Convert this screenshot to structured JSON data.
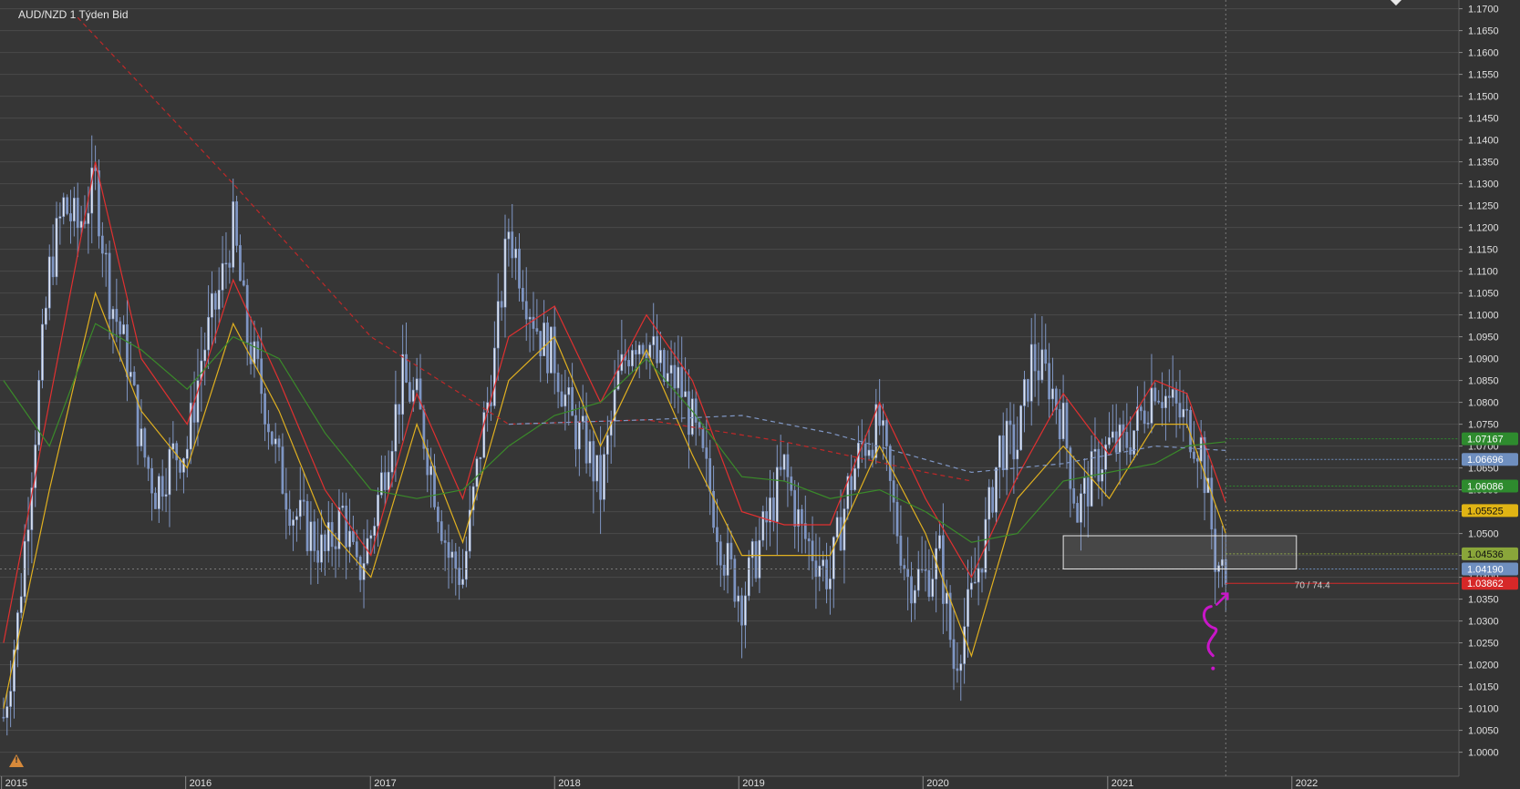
{
  "header": {
    "title": "AUD/NZD  1 Týden Bid"
  },
  "chart_data": {
    "type": "candlestick",
    "title": "AUD/NZD  1 Týden Bid",
    "xlabel": "",
    "ylabel": "",
    "ylim": [
      0.9945,
      1.172
    ],
    "x_range": [
      "2014-12-29",
      "2022-11-28"
    ],
    "x_ticks": [
      "2015",
      "2016",
      "2017",
      "2018",
      "2019",
      "2020",
      "2021",
      "2022"
    ],
    "y_ticks": [
      "1.1700",
      "1.1650",
      "1.1600",
      "1.1550",
      "1.1500",
      "1.1450",
      "1.1400",
      "1.1350",
      "1.1300",
      "1.1250",
      "1.1200",
      "1.1150",
      "1.1100",
      "1.1050",
      "1.1000",
      "1.0950",
      "1.0900",
      "1.0850",
      "1.0800",
      "1.0750",
      "1.0700",
      "1.0650",
      "1.0600",
      "1.0550",
      "1.0500",
      "1.0450",
      "1.0400",
      "1.0350",
      "1.0300",
      "1.0250",
      "1.0200",
      "1.0150",
      "1.0100",
      "1.0050",
      "1.0000"
    ],
    "close_path": [
      [
        "2015-01-05",
        1.008
      ],
      [
        "2015-02-02",
        1.03
      ],
      [
        "2015-03-02",
        1.065
      ],
      [
        "2015-04-06",
        1.11
      ],
      [
        "2015-05-04",
        1.125
      ],
      [
        "2015-06-01",
        1.12
      ],
      [
        "2015-07-06",
        1.13
      ],
      [
        "2015-08-03",
        1.105
      ],
      [
        "2015-09-07",
        1.09
      ],
      [
        "2015-10-05",
        1.07
      ],
      [
        "2015-11-02",
        1.06
      ],
      [
        "2015-12-07",
        1.068
      ],
      [
        "2016-01-04",
        1.07
      ],
      [
        "2016-02-01",
        1.09
      ],
      [
        "2016-03-07",
        1.105
      ],
      [
        "2016-04-04",
        1.12
      ],
      [
        "2016-05-02",
        1.095
      ],
      [
        "2016-06-06",
        1.08
      ],
      [
        "2016-07-04",
        1.065
      ],
      [
        "2016-08-01",
        1.055
      ],
      [
        "2016-09-05",
        1.05
      ],
      [
        "2016-10-03",
        1.045
      ],
      [
        "2016-11-07",
        1.055
      ],
      [
        "2016-12-05",
        1.04
      ],
      [
        "2017-01-02",
        1.05
      ],
      [
        "2017-02-06",
        1.07
      ],
      [
        "2017-03-06",
        1.085
      ],
      [
        "2017-04-03",
        1.08
      ],
      [
        "2017-05-01",
        1.065
      ],
      [
        "2017-06-05",
        1.045
      ],
      [
        "2017-07-03",
        1.04
      ],
      [
        "2017-08-07",
        1.07
      ],
      [
        "2017-09-04",
        1.09
      ],
      [
        "2017-10-02",
        1.12
      ],
      [
        "2017-11-06",
        1.105
      ],
      [
        "2017-12-04",
        1.095
      ],
      [
        "2018-01-01",
        1.09
      ],
      [
        "2018-02-05",
        1.075
      ],
      [
        "2018-03-05",
        1.07
      ],
      [
        "2018-04-02",
        1.06
      ],
      [
        "2018-05-07",
        1.085
      ],
      [
        "2018-06-04",
        1.095
      ],
      [
        "2018-07-02",
        1.095
      ],
      [
        "2018-08-06",
        1.085
      ],
      [
        "2018-09-03",
        1.085
      ],
      [
        "2018-10-01",
        1.075
      ],
      [
        "2018-11-05",
        1.06
      ],
      [
        "2018-12-03",
        1.045
      ],
      [
        "2019-01-07",
        1.035
      ],
      [
        "2019-02-04",
        1.045
      ],
      [
        "2019-03-04",
        1.055
      ],
      [
        "2019-04-01",
        1.065
      ],
      [
        "2019-05-06",
        1.05
      ],
      [
        "2019-06-03",
        1.045
      ],
      [
        "2019-07-01",
        1.04
      ],
      [
        "2019-08-05",
        1.06
      ],
      [
        "2019-09-02",
        1.07
      ],
      [
        "2019-10-07",
        1.075
      ],
      [
        "2019-11-04",
        1.055
      ],
      [
        "2019-12-02",
        1.04
      ],
      [
        "2020-01-06",
        1.04
      ],
      [
        "2020-02-03",
        1.045
      ],
      [
        "2020-03-02",
        1.02
      ],
      [
        "2020-04-06",
        1.035
      ],
      [
        "2020-05-04",
        1.05
      ],
      [
        "2020-06-01",
        1.07
      ],
      [
        "2020-07-06",
        1.07
      ],
      [
        "2020-08-03",
        1.09
      ],
      [
        "2020-09-07",
        1.085
      ],
      [
        "2020-10-05",
        1.075
      ],
      [
        "2020-11-02",
        1.055
      ],
      [
        "2020-12-07",
        1.065
      ],
      [
        "2021-01-04",
        1.07
      ],
      [
        "2021-02-01",
        1.07
      ],
      [
        "2021-03-01",
        1.075
      ],
      [
        "2021-04-05",
        1.085
      ],
      [
        "2021-05-03",
        1.08
      ],
      [
        "2021-06-07",
        1.075
      ],
      [
        "2021-07-05",
        1.07
      ],
      [
        "2021-08-02",
        1.045
      ],
      [
        "2021-08-23",
        1.0386
      ]
    ],
    "overlays": [
      {
        "name": "",
        "color": "#e03030",
        "style": "solid",
        "points": [
          [
            "2015-01-05",
            1.025
          ],
          [
            "2015-04-06",
            1.08
          ],
          [
            "2015-07-06",
            1.135
          ],
          [
            "2015-10-05",
            1.09
          ],
          [
            "2016-01-04",
            1.075
          ],
          [
            "2016-04-04",
            1.108
          ],
          [
            "2016-07-04",
            1.085
          ],
          [
            "2016-10-03",
            1.06
          ],
          [
            "2017-01-02",
            1.045
          ],
          [
            "2017-04-03",
            1.082
          ],
          [
            "2017-07-03",
            1.058
          ],
          [
            "2017-10-02",
            1.095
          ],
          [
            "2018-01-01",
            1.102
          ],
          [
            "2018-04-02",
            1.08
          ],
          [
            "2018-07-02",
            1.1
          ],
          [
            "2018-10-01",
            1.085
          ],
          [
            "2019-01-07",
            1.055
          ],
          [
            "2019-04-01",
            1.052
          ],
          [
            "2019-07-01",
            1.052
          ],
          [
            "2019-10-07",
            1.08
          ],
          [
            "2020-01-06",
            1.058
          ],
          [
            "2020-04-06",
            1.04
          ],
          [
            "2020-07-06",
            1.063
          ],
          [
            "2020-10-05",
            1.082
          ],
          [
            "2021-01-04",
            1.068
          ],
          [
            "2021-04-05",
            1.085
          ],
          [
            "2021-06-07",
            1.082
          ],
          [
            "2021-08-23",
            1.057
          ]
        ]
      },
      {
        "name": "",
        "color": "#e0b020",
        "style": "solid",
        "points": [
          [
            "2015-01-05",
            1.01
          ],
          [
            "2015-04-06",
            1.06
          ],
          [
            "2015-07-06",
            1.105
          ],
          [
            "2015-10-05",
            1.078
          ],
          [
            "2016-01-04",
            1.065
          ],
          [
            "2016-04-04",
            1.098
          ],
          [
            "2016-07-04",
            1.078
          ],
          [
            "2016-10-03",
            1.052
          ],
          [
            "2017-01-02",
            1.04
          ],
          [
            "2017-04-03",
            1.075
          ],
          [
            "2017-07-03",
            1.048
          ],
          [
            "2017-10-02",
            1.085
          ],
          [
            "2018-01-01",
            1.095
          ],
          [
            "2018-04-02",
            1.07
          ],
          [
            "2018-07-02",
            1.092
          ],
          [
            "2018-10-01",
            1.068
          ],
          [
            "2019-01-07",
            1.045
          ],
          [
            "2019-04-01",
            1.045
          ],
          [
            "2019-07-01",
            1.045
          ],
          [
            "2019-10-07",
            1.07
          ],
          [
            "2020-01-06",
            1.05
          ],
          [
            "2020-04-06",
            1.022
          ],
          [
            "2020-07-06",
            1.058
          ],
          [
            "2020-10-05",
            1.07
          ],
          [
            "2021-01-04",
            1.058
          ],
          [
            "2021-04-05",
            1.075
          ],
          [
            "2021-06-07",
            1.075
          ],
          [
            "2021-08-23",
            1.05
          ]
        ]
      },
      {
        "name": "",
        "color": "#3a8a2a",
        "style": "solid",
        "points": [
          [
            "2015-01-05",
            1.085
          ],
          [
            "2015-04-06",
            1.07
          ],
          [
            "2015-07-06",
            1.098
          ],
          [
            "2015-10-05",
            1.092
          ],
          [
            "2016-01-04",
            1.083
          ],
          [
            "2016-04-04",
            1.095
          ],
          [
            "2016-07-04",
            1.09
          ],
          [
            "2016-10-03",
            1.073
          ],
          [
            "2017-01-02",
            1.06
          ],
          [
            "2017-04-03",
            1.058
          ],
          [
            "2017-07-03",
            1.06
          ],
          [
            "2017-10-02",
            1.07
          ],
          [
            "2018-01-01",
            1.077
          ],
          [
            "2018-04-02",
            1.08
          ],
          [
            "2018-07-02",
            1.09
          ],
          [
            "2018-10-01",
            1.078
          ],
          [
            "2019-01-07",
            1.063
          ],
          [
            "2019-04-01",
            1.062
          ],
          [
            "2019-07-01",
            1.058
          ],
          [
            "2019-10-07",
            1.06
          ],
          [
            "2020-01-06",
            1.055
          ],
          [
            "2020-04-06",
            1.048
          ],
          [
            "2020-07-06",
            1.05
          ],
          [
            "2020-10-05",
            1.062
          ],
          [
            "2021-01-04",
            1.064
          ],
          [
            "2021-04-05",
            1.066
          ],
          [
            "2021-06-07",
            1.07
          ],
          [
            "2021-08-23",
            1.071
          ]
        ]
      },
      {
        "name": "",
        "color": "#c02828",
        "style": "dashed",
        "points": [
          [
            "2015-06-01",
            1.168
          ],
          [
            "2016-04-04",
            1.13
          ],
          [
            "2017-01-02",
            1.095
          ],
          [
            "2017-10-02",
            1.075
          ],
          [
            "2018-07-02",
            1.076
          ],
          [
            "2019-04-01",
            1.071
          ],
          [
            "2020-01-06",
            1.064
          ],
          [
            "2020-04-06",
            1.062
          ]
        ]
      },
      {
        "name": "",
        "color": "#7f96c4",
        "style": "dashed",
        "points": [
          [
            "2017-10-02",
            1.075
          ],
          [
            "2018-07-02",
            1.076
          ],
          [
            "2019-01-07",
            1.077
          ],
          [
            "2019-07-01",
            1.073
          ],
          [
            "2020-04-06",
            1.064
          ],
          [
            "2020-10-05",
            1.066
          ],
          [
            "2021-04-05",
            1.07
          ],
          [
            "2021-08-23",
            1.069
          ]
        ]
      }
    ],
    "price_levels": [
      {
        "label": "1.07167",
        "color": "#2e8b2e",
        "text_color": "#ffffff",
        "value": 1.07167
      },
      {
        "label": "1.06696",
        "color": "#6f8fbf",
        "text_color": "#ffffff",
        "value": 1.06696
      },
      {
        "label": "1.06086",
        "color": "#2e8b2e",
        "text_color": "#ffffff",
        "value": 1.06086
      },
      {
        "label": "1.05525",
        "color": "#e0b414",
        "text_color": "#111111",
        "value": 1.05525
      },
      {
        "label": "1.04536",
        "color": "#8aa63a",
        "text_color": "#111111",
        "value": 1.04536
      },
      {
        "label": "1.04190",
        "color": "#6f8fbf",
        "text_color": "#ffffff",
        "value": 1.0419
      },
      {
        "label": "1.03862",
        "color": "#d62828",
        "text_color": "#ffffff",
        "value": 1.03862
      }
    ],
    "annotations": {
      "box": {
        "x_start": "2020-10-05",
        "x_end": "2022-01-10",
        "y_low": 1.0419,
        "y_high": 1.0495
      },
      "current_bar": "2021-08-23",
      "measure_text": "70 / 74.4"
    },
    "colors": {
      "background": "#363636",
      "candle": "#7f96c4",
      "grid": "#4a4a4a",
      "annotation": "#c816c8"
    },
    "grid": true
  }
}
